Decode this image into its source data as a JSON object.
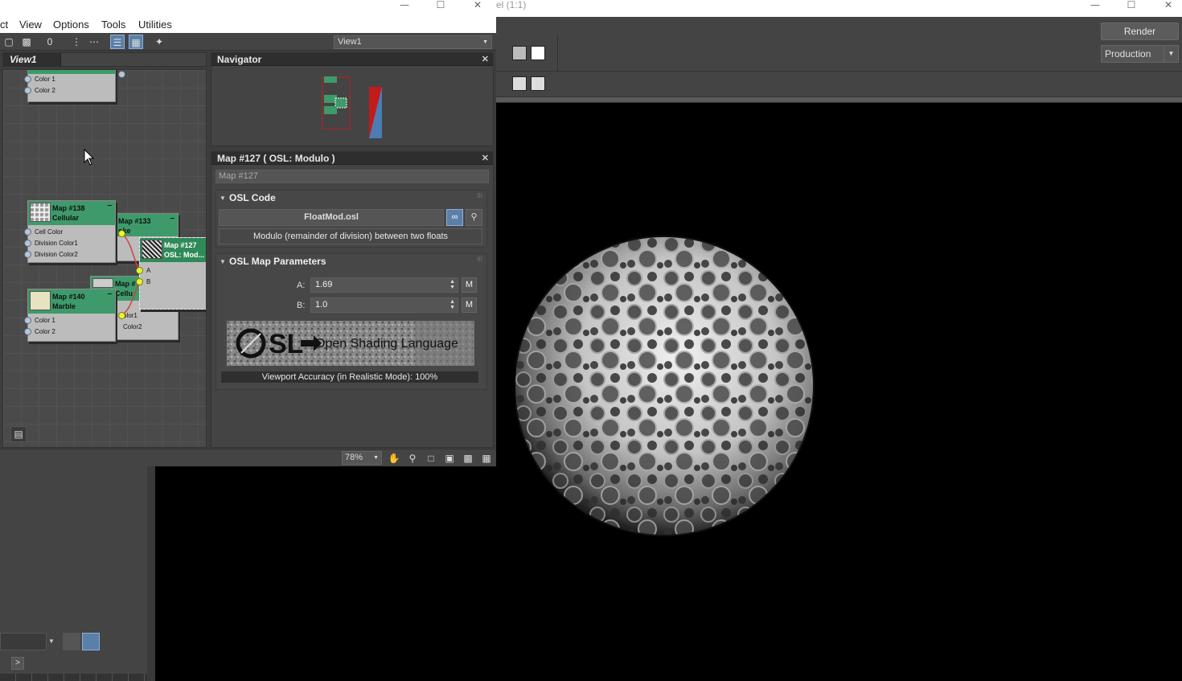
{
  "render_window": {
    "title": "el (1:1)",
    "render_button": "Render",
    "production_select": "Production"
  },
  "slate": {
    "menu": [
      "ct",
      "View",
      "Options",
      "Tools",
      "Utilities"
    ],
    "view_select": "View1",
    "view_tab": "View1",
    "nodes": {
      "top": {
        "slots": [
          "Color 1",
          "Color 2"
        ]
      },
      "map138": {
        "title_line1": "Map #138",
        "title_line2": "Cellular",
        "slots": [
          "Cell Color",
          "Division Color1",
          "Division Color2"
        ]
      },
      "map133": {
        "title_line1": "Map #133",
        "title_line2": "oke"
      },
      "map127": {
        "title_line1": "Map #127",
        "title_line2": "OSL: Mod...",
        "slots": [
          "A",
          "B"
        ]
      },
      "mapmid": {
        "title_line1": "Map #",
        "title_line2": "Cellu",
        "slots": [
          "olor1",
          "Color2"
        ]
      },
      "map140": {
        "title_line1": "Map #140",
        "title_line2": "Marble",
        "slots": [
          "Color 1",
          "Color 2"
        ]
      }
    },
    "navigator": {
      "title": "Navigator"
    },
    "params": {
      "title": "Map #127  ( OSL: Modulo )",
      "map_name": "Map #127",
      "osl_code": {
        "header": "OSL Code",
        "file": "FloatMod.osl",
        "description": "Modulo (remainder of division) between two floats"
      },
      "osl_params": {
        "header": "OSL Map Parameters",
        "a_label": "A:",
        "a_value": "1.69",
        "b_label": "B:",
        "b_value": "1.0",
        "m_label": "M"
      },
      "banner_logo": "OSL",
      "banner_text": "Open Shading Language",
      "viewport_accuracy": "Viewport Accuracy (in Realistic Mode): 100%"
    },
    "status": {
      "zoom": "78%"
    }
  },
  "max": {
    "next_label": ">"
  },
  "colors": {
    "node_header": "#3e9a6a",
    "link_accent": "#5a7fa8",
    "panel_bg": "#444444"
  }
}
